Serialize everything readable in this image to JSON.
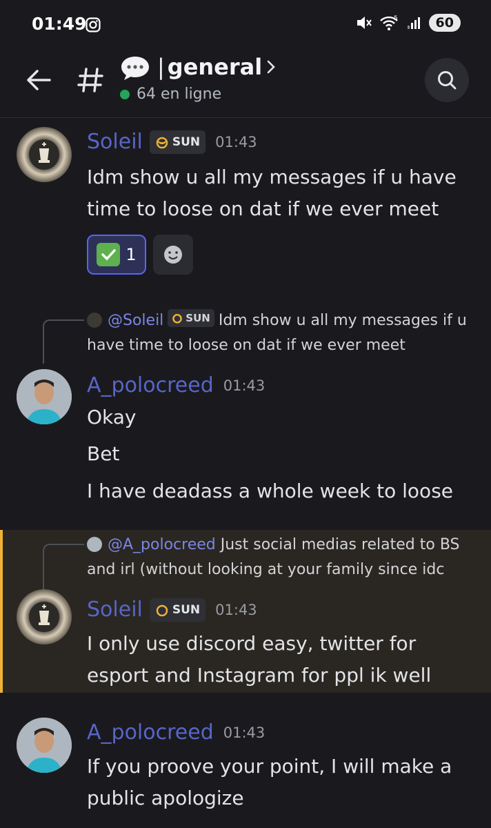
{
  "status_bar": {
    "time": "01:49",
    "battery": "60",
    "signal_label": "5"
  },
  "header": {
    "channel_sep": "|",
    "channel_name": "general",
    "online": "64 en ligne"
  },
  "messages": [
    {
      "user": "Soleil",
      "tag": "SUN",
      "time": "01:43",
      "lines": [
        "Idm show u all my messages if u have time to loose on dat if we ever meet"
      ],
      "reaction": {
        "emoji": "check-mark",
        "count": "1"
      }
    },
    {
      "reply": {
        "mention": "@Soleil",
        "tag": "SUN",
        "text": "Idm show u all my messages if u have time to loose on dat if we ever meet"
      },
      "user": "A_polocreed",
      "time": "01:43",
      "lines": [
        "Okay",
        "Bet",
        "I have deadass a whole week to loose"
      ]
    },
    {
      "reply": {
        "mention": "@A_polocreed",
        "text": "Just social medias related to BS and irl (without looking at your family since idc"
      },
      "user": "Soleil",
      "tag": "SUN",
      "time": "01:43",
      "lines": [
        "I only use discord easy, twitter for esport and Instagram for ppl ik well"
      ]
    },
    {
      "user": "A_polocreed",
      "time": "01:43",
      "lines": [
        "If you proove your point, I will make a public apologize"
      ]
    }
  ],
  "colors": {
    "background": "#1a1a1e",
    "username": "#5865c8",
    "online": "#23a55a",
    "highlight_bar": "#f0b232"
  }
}
